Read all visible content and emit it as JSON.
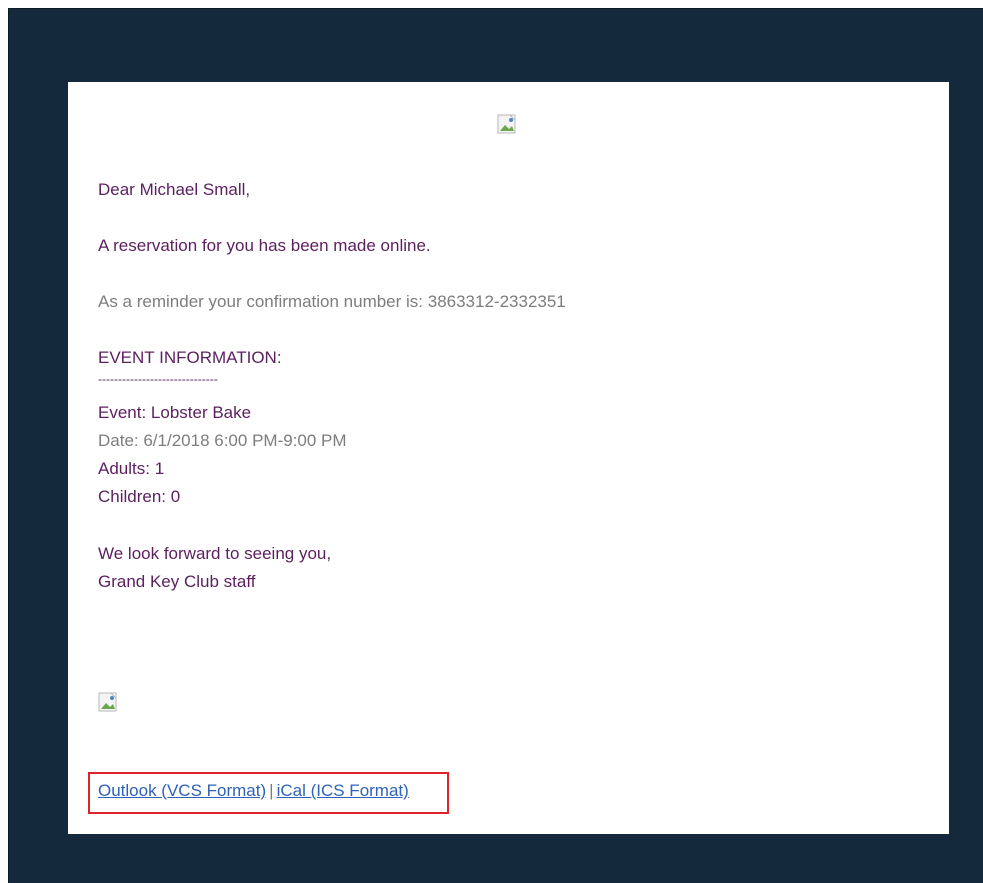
{
  "email": {
    "greeting": "Dear Michael Small,",
    "intro": "A reservation for you has been made online.",
    "confirmation": "As a reminder your confirmation number is: 3863312-2332351",
    "section_title": "EVENT INFORMATION:",
    "divider": "------------------------------",
    "event": "Event: Lobster Bake",
    "date": "Date: 6/1/2018 6:00 PM-9:00 PM",
    "adults": "Adults: 1",
    "children": "Children: 0",
    "closing": "We look forward to seeing you,",
    "signature": "Grand Key Club staff"
  },
  "links": {
    "outlook": "Outlook (VCS Format)",
    "separator": "|",
    "ical": "iCal (ICS Format)"
  },
  "colors": {
    "background": "#142a3c",
    "text_purple": "#5b1f5f",
    "text_grey": "#7d7d7d",
    "link": "#2f62b8",
    "highlight": "#e0222a"
  }
}
